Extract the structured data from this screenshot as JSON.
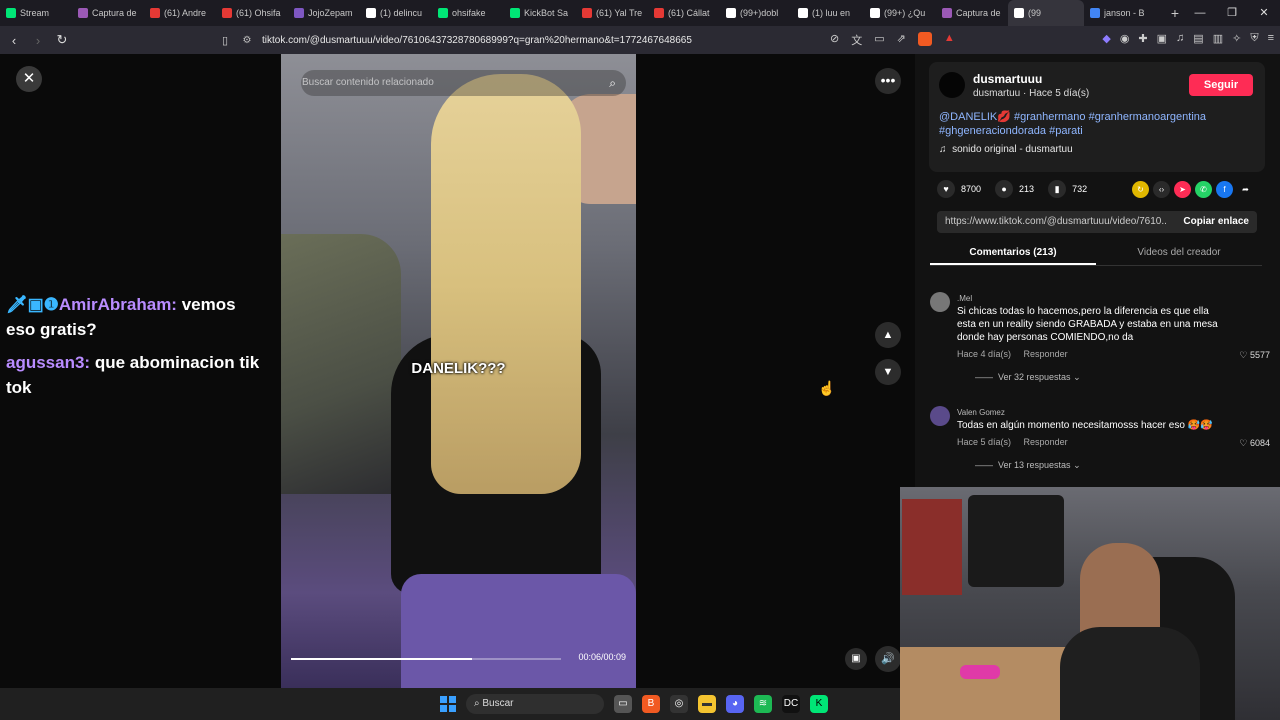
{
  "browser": {
    "tabs": [
      {
        "label": "Stream",
        "color": "#00e676"
      },
      {
        "label": "Captura de",
        "color": "#9b59b6"
      },
      {
        "label": "(61) Andre",
        "color": "#e53935"
      },
      {
        "label": "(61) Ohsifa",
        "color": "#e53935"
      },
      {
        "label": "JojoZepam",
        "color": "#7e57c2"
      },
      {
        "label": "(1) delincu",
        "color": "#ffffff"
      },
      {
        "label": "ohsifake",
        "color": "#00e676"
      },
      {
        "label": "KickBot Sa",
        "color": "#00e676"
      },
      {
        "label": "(61) Yal Tre",
        "color": "#e53935"
      },
      {
        "label": "(61) Cállat",
        "color": "#e53935"
      },
      {
        "label": "(99+)dobl",
        "color": "#ffffff"
      },
      {
        "label": "(1) luu en",
        "color": "#ffffff"
      },
      {
        "label": "(99+) ¿Qu",
        "color": "#ffffff"
      },
      {
        "label": "Captura de",
        "color": "#9b59b6"
      },
      {
        "label": "(99",
        "color": "#ffffff",
        "active": true
      },
      {
        "label": "janson - B",
        "color": "#4285f4"
      }
    ],
    "new_tab": "+",
    "url": "tiktok.com/@dusmartuuu/video/7610643732878068999?q=gran%20hermano&t=1772467648665"
  },
  "video": {
    "search_placeholder": "Buscar contenido relacionado",
    "caption": "DANELIK???",
    "time": "00:06/00:09",
    "progress_fraction": 0.67
  },
  "chat": [
    {
      "badges": "🗡▣❶",
      "user": "AmirAbraham:",
      "text": "vemos eso gratis?"
    },
    {
      "badges": "",
      "user": "agussan3:",
      "text": "que abominacion tik tok"
    }
  ],
  "creator": {
    "name": "dusmartuuu",
    "sub": "dusmartuu · Hace 5 día(s)",
    "follow": "Seguir",
    "desc": "@DANELIK💋 #granhermano #granhermanoargentina #ghgeneraciondorada #parati",
    "sound": "sonido original - dusmartuu"
  },
  "stats": {
    "likes": "8700",
    "comments": "213",
    "saves": "732"
  },
  "link": {
    "url": "https://www.tiktok.com/@dusmartuuu/video/7610...",
    "copy": "Copiar enlace"
  },
  "side_tabs": {
    "comments": "Comentarios (213)",
    "creator_videos": "Videos del creador"
  },
  "comments": [
    {
      "user": ".Mel",
      "text": "Si chicas todas lo hacemos,pero la diferencia es que ella esta en un reality siendo GRABADA y estaba en una mesa donde hay personas COMIENDO,no da",
      "time": "Hace 4 día(s)",
      "reply": "Responder",
      "likes": "5577",
      "more": "Ver 32 respuestas"
    },
    {
      "user": "Valen Gomez",
      "text": "Todas en algún momento necesitamosss hacer eso 🥵🥵",
      "time": "Hace 5 día(s)",
      "reply": "Responder",
      "likes": "6084",
      "more": "Ver 13 respuestas"
    }
  ],
  "taskbar": {
    "search": "Buscar"
  }
}
